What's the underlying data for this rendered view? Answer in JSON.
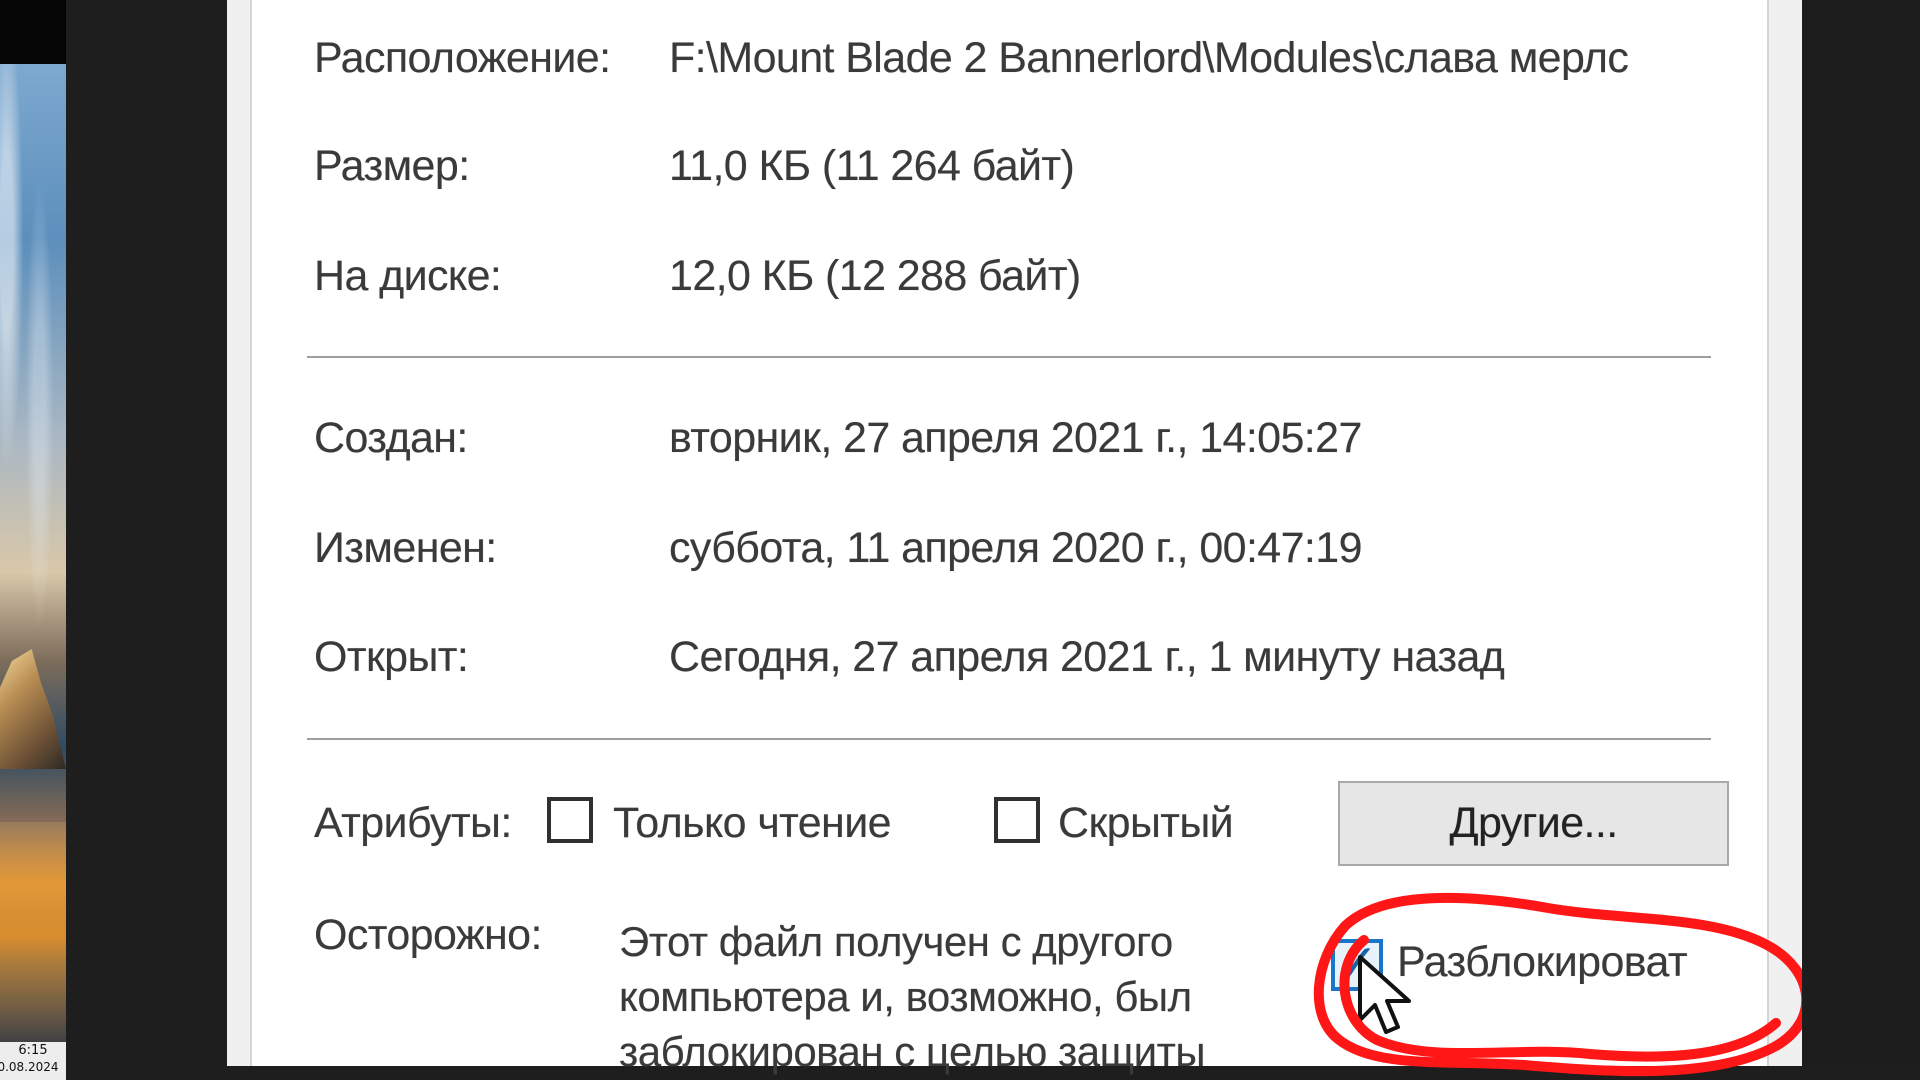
{
  "taskbar": {
    "time": "6:15",
    "date": "0.08.2024"
  },
  "properties": {
    "location": {
      "label": "Расположение:",
      "value": "F:\\Mount Blade 2 Bannerlord\\Modules\\слава мерлс"
    },
    "size": {
      "label": "Размер:",
      "value": "11,0 КБ (11 264 байт)"
    },
    "disk": {
      "label": "На диске:",
      "value": "12,0 КБ (12 288 байт)"
    },
    "created": {
      "label": "Создан:",
      "value": "вторник, 27 апреля 2021 г., 14:05:27"
    },
    "modified": {
      "label": "Изменен:",
      "value": "суббота, 11 апреля 2020 г., 00:47:19"
    },
    "opened": {
      "label": "Открыт:",
      "value": "Сегодня, 27 апреля 2021 г., 1 минуту назад"
    }
  },
  "attributes": {
    "label": "Атрибуты:",
    "readonly_label": "Только чтение",
    "hidden_label": "Скрытый",
    "other_button": "Другие..."
  },
  "security": {
    "label": "Осторожно:",
    "warning_lines": [
      "Этот файл получен с другого",
      "компьютера и, возможно, был",
      "заблокирован с целью защиты"
    ],
    "unblock_label": "Разблокироват",
    "unblock_checked": true
  },
  "colors": {
    "dialog_background": "#ffffff",
    "text": "#3a3a3a",
    "highlight_red": "#ff1616",
    "checkbox_blue": "#1976c8"
  },
  "icons": {
    "checked_checkbox": "checkmark-icon",
    "pointer": "mouse-pointer-icon"
  }
}
